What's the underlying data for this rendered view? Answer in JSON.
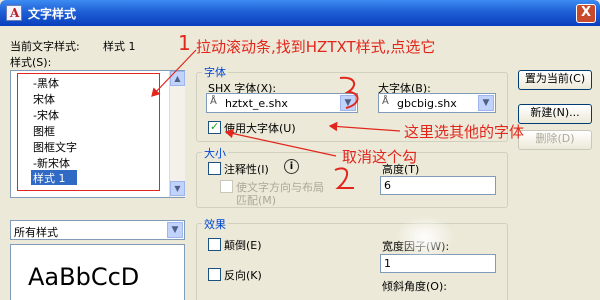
{
  "window": {
    "title": "文字样式",
    "close_label": "X"
  },
  "current_style": {
    "label": "当前文字样式:",
    "value": "样式 1"
  },
  "styles": {
    "label": "样式(S):",
    "items": [
      "-黑体",
      "宋体",
      "-宋体",
      "图框",
      "图框文字",
      "-新宋体",
      "样式 1"
    ],
    "selected": "样式 1"
  },
  "filter": {
    "value": "所有样式"
  },
  "preview": {
    "text": "AaBbCcD"
  },
  "font": {
    "group_title": "字体",
    "shx_label": "SHX 字体(X):",
    "shx_value": "hztxt_e.shx",
    "big_label": "大字体(B):",
    "big_value": "gbcbig.shx",
    "use_big_label": "使用大字体(U)"
  },
  "size": {
    "group_title": "大小",
    "annotative_label": "注释性(I)",
    "annotative_info": "i",
    "orient_label_line1": "使文字方向与布局",
    "orient_label_line2": "匹配(M)",
    "height_label": "高度(T)",
    "height_value": "6"
  },
  "effects": {
    "group_title": "效果",
    "upside_down_label": "颠倒(E)",
    "backwards_label": "反向(K)",
    "width_label": "宽度因子(W):",
    "width_value": "1",
    "oblique_label": "倾斜角度(O):"
  },
  "buttons": {
    "set_current": "置为当前(C)",
    "new": "新建(N)...",
    "delete": "删除(D)"
  },
  "annotations": {
    "step1": "拉动滚动条,找到HZTXT样式,点选它",
    "step1_num": "1",
    "step2": "这里选其他的字体",
    "step3": "取消这个勾",
    "num2": "2",
    "num3": "3"
  },
  "colors": {
    "annotation": "#e2261c",
    "titlebar": "#1f5fd6",
    "selection": "#316ac5",
    "group_title": "#0046d5"
  }
}
